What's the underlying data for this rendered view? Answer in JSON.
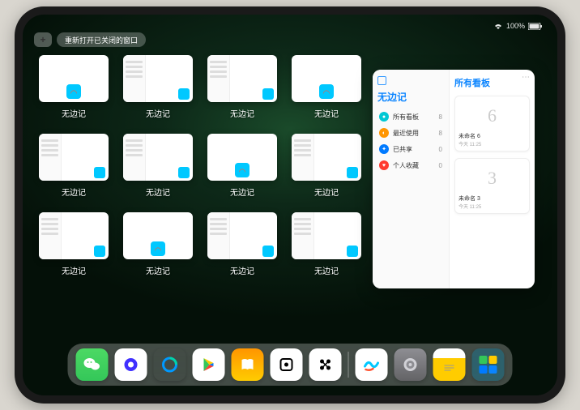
{
  "status": {
    "battery": "100%",
    "wifi": "wifi"
  },
  "topbar": {
    "add_label": "+",
    "reopen_label": "重新打开已关闭的窗口"
  },
  "app_name": "无边记",
  "windows": [
    {
      "type": "blank"
    },
    {
      "type": "detail"
    },
    {
      "type": "detail"
    },
    {
      "type": "blank"
    },
    {
      "type": "detail"
    },
    {
      "type": "detail"
    },
    {
      "type": "blank"
    },
    {
      "type": "detail"
    },
    {
      "type": "detail"
    },
    {
      "type": "blank"
    },
    {
      "type": "detail"
    },
    {
      "type": "detail"
    }
  ],
  "big_window": {
    "sidebar_title": "无边记",
    "main_title": "所有看板",
    "items": [
      {
        "icon": "cyan",
        "label": "所有看板",
        "count": "8"
      },
      {
        "icon": "orange",
        "label": "最近使用",
        "count": "8"
      },
      {
        "icon": "blue",
        "label": "已共享",
        "count": "0"
      },
      {
        "icon": "red",
        "label": "个人收藏",
        "count": "0"
      }
    ],
    "boards": [
      {
        "sketch": "6",
        "name": "未命名 6",
        "time": "今天 11:25"
      },
      {
        "sketch": "3",
        "name": "未命名 3",
        "time": "今天 11:25"
      }
    ]
  },
  "dock": {
    "apps": [
      {
        "id": "wechat",
        "name": "WeChat"
      },
      {
        "id": "quark",
        "name": "Quark"
      },
      {
        "id": "qq-browser",
        "name": "QQ Browser"
      },
      {
        "id": "play",
        "name": "Play"
      },
      {
        "id": "books",
        "name": "Books"
      },
      {
        "id": "dice",
        "name": "Dice"
      },
      {
        "id": "dots",
        "name": "Dots"
      }
    ],
    "recent": [
      {
        "id": "freeform",
        "name": "Freeform"
      },
      {
        "id": "settings",
        "name": "Settings"
      },
      {
        "id": "notes",
        "name": "Notes"
      },
      {
        "id": "group",
        "name": "App Group"
      }
    ]
  }
}
